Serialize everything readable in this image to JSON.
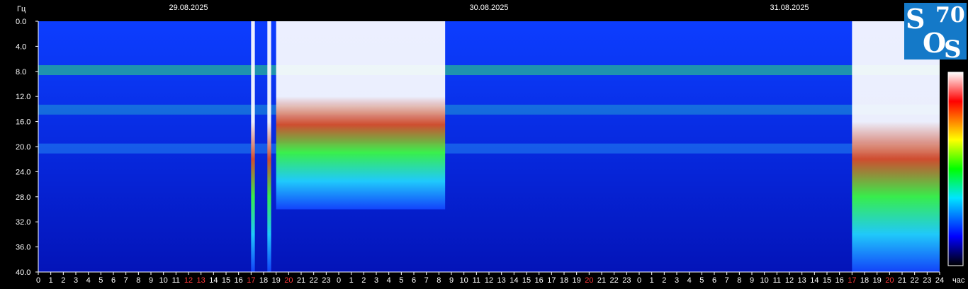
{
  "chart_data": {
    "type": "heatmap",
    "title": "",
    "ylabel": "Гц",
    "xlabel": "час",
    "dates": [
      "29.08.2025",
      "30.08.2025",
      "31.08.2025"
    ],
    "y_ticks": [
      "0.0",
      "4.0",
      "8.0",
      "12.0",
      "16.0",
      "20.0",
      "24.0",
      "28.0",
      "32.0",
      "36.0",
      "40.0"
    ],
    "ylim": [
      0,
      40
    ],
    "xlim_hours": [
      0,
      72
    ],
    "x_ticks": [
      "0",
      "1",
      "2",
      "3",
      "4",
      "5",
      "6",
      "7",
      "8",
      "9",
      "10",
      "11",
      "12",
      "13",
      "14",
      "15",
      "16",
      "17",
      "18",
      "19",
      "20",
      "21",
      "22",
      "23",
      "0",
      "1",
      "2",
      "3",
      "4",
      "5",
      "6",
      "7",
      "8",
      "9",
      "10",
      "11",
      "12",
      "13",
      "14",
      "15",
      "16",
      "17",
      "18",
      "19",
      "20",
      "21",
      "22",
      "23",
      "0",
      "1",
      "2",
      "3",
      "4",
      "5",
      "6",
      "7",
      "8",
      "9",
      "10",
      "11",
      "12",
      "13",
      "14",
      "15",
      "16",
      "17",
      "18",
      "19",
      "20",
      "21",
      "22",
      "23",
      "24"
    ],
    "highlighted_x_ticks": [
      12,
      13,
      17,
      20,
      44,
      65,
      68
    ],
    "grid": false,
    "colorbar": [
      "#000000",
      "#0000ff",
      "#00e5ff",
      "#00ff00",
      "#ffff00",
      "#ff0000",
      "#ffffff"
    ],
    "resonance_bands_hz": [
      7.8,
      14.1,
      20.3
    ],
    "events": [
      {
        "start_hour": 17.0,
        "end_hour": 17.3,
        "max_hz": 40
      },
      {
        "start_hour": 18.3,
        "end_hour": 18.6,
        "max_hz": 40
      },
      {
        "start_hour": 19.0,
        "end_hour": 32.5,
        "max_hz": 30
      },
      {
        "start_hour": 65.0,
        "end_hour": 72.0,
        "max_hz": 40
      }
    ]
  },
  "logo": {
    "text_s1": "S",
    "text_num": "70",
    "text_o": "O",
    "text_s2": "S",
    "color": "#1479c8"
  }
}
